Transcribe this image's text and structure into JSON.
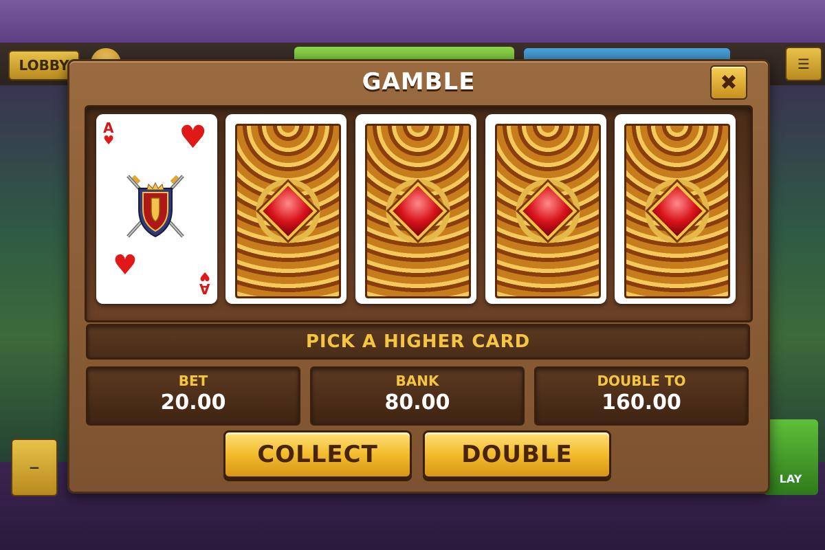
{
  "dialog": {
    "title": "GAMBLE",
    "close_label": "✖"
  },
  "background": {
    "lobby_label": "LOBBY",
    "bottom_right_label": "LAY"
  },
  "cards": [
    {
      "face": "up",
      "rank": "A",
      "suit": "heart",
      "suit_glyph": "♥"
    },
    {
      "face": "down"
    },
    {
      "face": "down"
    },
    {
      "face": "down"
    },
    {
      "face": "down"
    }
  ],
  "message": "PICK A HIGHER CARD",
  "stats": {
    "bet": {
      "label": "BET",
      "value": "20.00"
    },
    "bank": {
      "label": "BANK",
      "value": "80.00"
    },
    "double_to": {
      "label": "DOUBLE TO",
      "value": "160.00"
    }
  },
  "buttons": {
    "collect": "COLLECT",
    "double": "DOUBLE"
  },
  "colors": {
    "panel_brown": "#8a5a34",
    "gold_text": "#f4c542",
    "button_gold": "#f2bc2c",
    "gem_red": "#d8141c"
  }
}
